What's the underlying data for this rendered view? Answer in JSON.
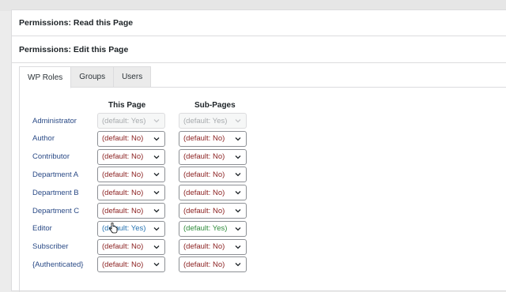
{
  "panels": {
    "read_title": "Permissions: Read this Page",
    "edit_title": "Permissions: Edit this Page"
  },
  "tabs": [
    {
      "label": "WP Roles",
      "active": true
    },
    {
      "label": "Groups",
      "active": false
    },
    {
      "label": "Users",
      "active": false
    }
  ],
  "columns": {
    "this_page": "This Page",
    "sub_pages": "Sub-Pages"
  },
  "colors": {
    "role_label": "#2a4a86",
    "no": "#8a1f1f",
    "yes_this_page": "#2271b1",
    "yes_sub_pages": "#2e8b3a",
    "disabled": "#a7aaad"
  },
  "roles": [
    {
      "label": "Administrator",
      "this_page": "(default: Yes)",
      "sub_pages": "(default: Yes)",
      "disabled": true
    },
    {
      "label": "Author",
      "this_page": "(default: No)",
      "sub_pages": "(default: No)",
      "disabled": false
    },
    {
      "label": "Contributor",
      "this_page": "(default: No)",
      "sub_pages": "(default: No)",
      "disabled": false
    },
    {
      "label": "Department A",
      "this_page": "(default: No)",
      "sub_pages": "(default: No)",
      "disabled": false
    },
    {
      "label": "Department B",
      "this_page": "(default: No)",
      "sub_pages": "(default: No)",
      "disabled": false
    },
    {
      "label": "Department C",
      "this_page": "(default: No)",
      "sub_pages": "(default: No)",
      "disabled": false
    },
    {
      "label": "Editor",
      "this_page": "(default: Yes)",
      "sub_pages": "(default: Yes)",
      "disabled": false
    },
    {
      "label": "Subscriber",
      "this_page": "(default: No)",
      "sub_pages": "(default: No)",
      "disabled": false
    },
    {
      "label": "{Authenticated}",
      "this_page": "(default: No)",
      "sub_pages": "(default: No)",
      "disabled": false
    }
  ]
}
